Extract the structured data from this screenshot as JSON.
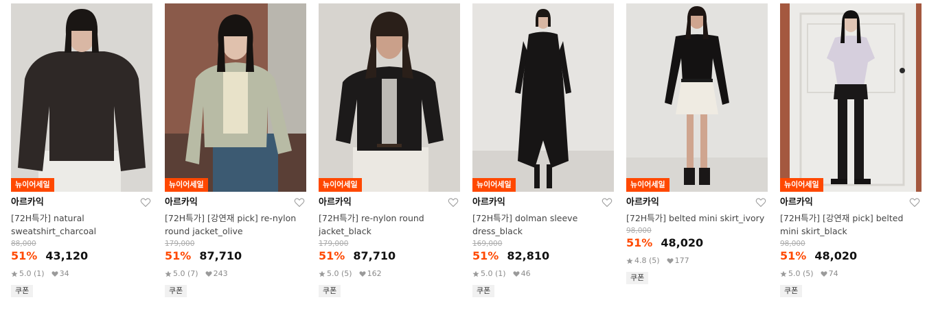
{
  "products": [
    {
      "badge": "뉴이어세일",
      "brand": "아르카익",
      "name": "[72H특가] natural sweatshirt_charcoal",
      "original_price": "88,000",
      "discount": "51%",
      "price": "43,120",
      "rating": "5.0",
      "review_count": "(1)",
      "likes": "34",
      "coupon": "쿠폰",
      "photo": {
        "bg": "#d9d7d3",
        "top": "#2e2826",
        "bottom": "#ecebe7",
        "hair": "#1a1614",
        "skin": "#d9b7a4"
      }
    },
    {
      "badge": "뉴이어세일",
      "brand": "아르카익",
      "name": "[72H특가] [강연재 pick] re-nylon round jacket_olive",
      "original_price": "179,000",
      "discount": "51%",
      "price": "87,710",
      "rating": "5.0",
      "review_count": "(7)",
      "likes": "243",
      "coupon": "쿠폰",
      "photo": {
        "bg": "#8a5a4a",
        "top": "#b8bba5",
        "bottom": "#3c5a72",
        "hair": "#171311",
        "skin": "#e0c1ad"
      }
    },
    {
      "badge": "뉴이어세일",
      "brand": "아르카익",
      "name": "[72H특가] re-nylon round jacket_black",
      "original_price": "179,000",
      "discount": "51%",
      "price": "87,710",
      "rating": "5.0",
      "review_count": "(5)",
      "likes": "162",
      "coupon": "쿠폰",
      "photo": {
        "bg": "#d7d4cf",
        "top": "#1c1a1a",
        "bottom": "#ebe8e2",
        "hair": "#2a1f19",
        "skin": "#caa08a"
      }
    },
    {
      "badge": "뉴이어세일",
      "brand": "아르카익",
      "name": "[72H특가] dolman sleeve dress_black",
      "original_price": "169,000",
      "discount": "51%",
      "price": "82,810",
      "rating": "5.0",
      "review_count": "(1)",
      "likes": "46",
      "coupon": "쿠폰",
      "photo": {
        "bg": "#e6e4e1",
        "top": "#171515",
        "bottom": "#171515",
        "hair": "#1c1714",
        "skin": "#d8b6a2"
      }
    },
    {
      "badge": "뉴이어세일",
      "brand": "아르카익",
      "name": "[72H특가] belted mini skirt_ivory",
      "original_price": "98,000",
      "discount": "51%",
      "price": "48,020",
      "rating": "4.8",
      "review_count": "(5)",
      "likes": "177",
      "coupon": "쿠폰",
      "photo": {
        "bg": "#e3e2df",
        "top": "#141212",
        "bottom": "#efebe2",
        "hair": "#1d1512",
        "skin": "#cfa58f"
      }
    },
    {
      "badge": "뉴이어세일",
      "brand": "아르카익",
      "name": "[72H특가] [강연재 pick] belted mini skirt_black",
      "original_price": "98,000",
      "discount": "51%",
      "price": "48,020",
      "rating": "5.0",
      "review_count": "(5)",
      "likes": "74",
      "coupon": "쿠폰",
      "photo": {
        "bg": "#ecebe8",
        "top": "#d6cfdd",
        "bottom": "#1a1818",
        "hair": "#121010",
        "skin": "#e0c4b3"
      }
    }
  ],
  "colors": {
    "accent": "#ff4800",
    "text": "#111111",
    "muted": "#8a8a8a"
  }
}
